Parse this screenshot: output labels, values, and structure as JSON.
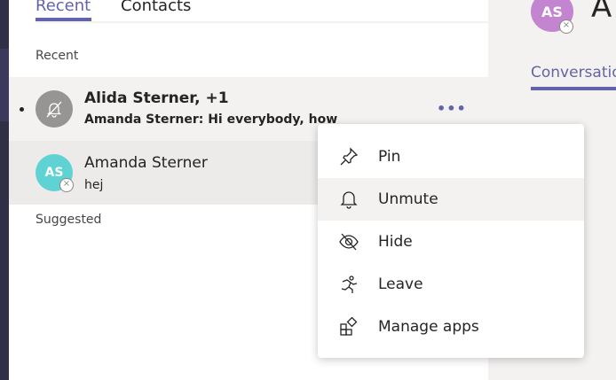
{
  "tabs": [
    {
      "label": "Recent"
    },
    {
      "label": "Contacts"
    }
  ],
  "sections": {
    "recent": "Recent",
    "suggested": "Suggested"
  },
  "chats": [
    {
      "name": "Alida Sterner, +1",
      "preview": "Amanda Sterner: Hi everybody, how are yo",
      "icon": "muted-bell-icon",
      "unread": true
    },
    {
      "name": "Amanda Sterner",
      "preview": "hej",
      "initials": "AS",
      "avatar_color": "#5fd3d3"
    }
  ],
  "more_label": "•••",
  "menu": [
    {
      "label": "Pin",
      "icon": "pin-icon"
    },
    {
      "label": "Unmute",
      "icon": "bell-icon"
    },
    {
      "label": "Hide",
      "icon": "hide-icon"
    },
    {
      "label": "Leave",
      "icon": "leave-icon"
    },
    {
      "label": "Manage apps",
      "icon": "apps-icon"
    }
  ],
  "right_pane": {
    "initials": "AS",
    "title": "A",
    "tab": "Conversations",
    "accent": "#6264a7"
  }
}
